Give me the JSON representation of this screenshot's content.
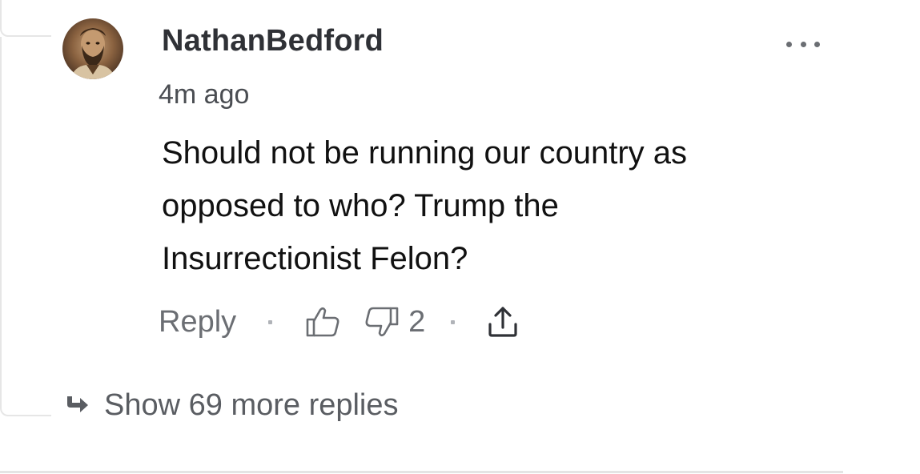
{
  "comment": {
    "username": "NathanBedford",
    "timestamp": "4m ago",
    "body_lines": [
      "Should not be running our country as",
      "opposed to who? Trump the",
      "Insurrectionist Felon?"
    ],
    "avatar_icon": "portrait-avatar"
  },
  "actions": {
    "reply_label": "Reply",
    "upvote_icon": "thumbs-up-icon",
    "downvote_icon": "thumbs-down-icon",
    "downvote_count": "2",
    "share_icon": "share-upload-icon"
  },
  "menu": {
    "icon": "more-options-icon"
  },
  "thread": {
    "show_replies_label": "Show 69 more replies",
    "icon": "reply-arrow-icon"
  },
  "colors": {
    "username": "#2f3136",
    "muted_text": "#6b6e73",
    "body_text": "#111111",
    "divider": "#e4e4e4"
  }
}
